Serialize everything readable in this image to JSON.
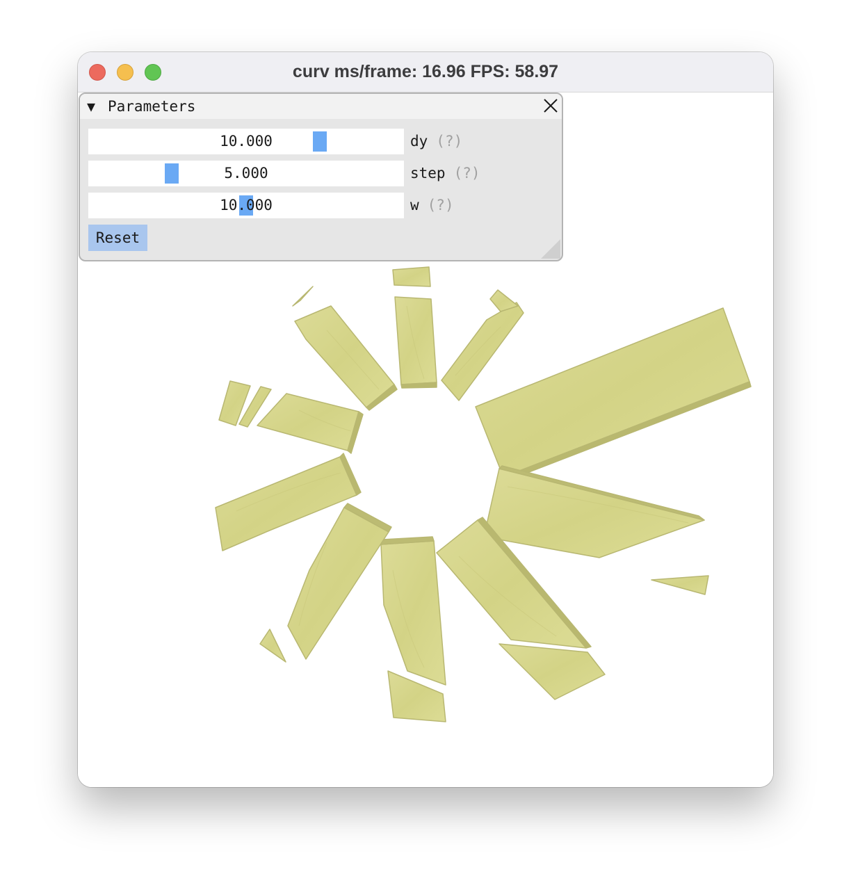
{
  "window": {
    "title": "curv ms/frame: 16.96 FPS: 58.97"
  },
  "panel": {
    "arrow": "▼",
    "title": "Parameters",
    "close_icon": "close-icon",
    "parameters": [
      {
        "label": "dy",
        "help": "(?)",
        "value": "10.000"
      },
      {
        "label": "step",
        "help": "(?)",
        "value": "5.000"
      },
      {
        "label": "w",
        "help": "(?)",
        "value": "10.000"
      }
    ],
    "reset_label": "Reset"
  },
  "colors": {
    "slider_grab": "#6aa9f4",
    "reset_button": "#a9c6ee",
    "shape_fill": "#d8d88c",
    "shape_edge": "#b4b36b"
  }
}
